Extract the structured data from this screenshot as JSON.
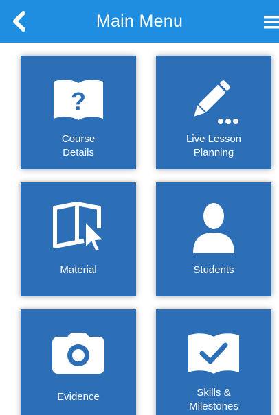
{
  "header": {
    "title": "Main Menu",
    "back_icon": "chevron-left-icon",
    "menu_icon": "hamburger-menu-icon",
    "color": "#1f8ee0"
  },
  "tiles": [
    {
      "label": "Course\nDetails",
      "icon": "book-question-icon"
    },
    {
      "label": "Live Lesson\nPlanning",
      "icon": "pencil-dots-icon"
    },
    {
      "label": "Material",
      "icon": "open-book-cursor-icon"
    },
    {
      "label": "Students",
      "icon": "person-silhouette-icon"
    },
    {
      "label": "Evidence",
      "icon": "camera-icon"
    },
    {
      "label": "Skills &\nMilestones",
      "icon": "book-checkmark-icon"
    }
  ],
  "tile_color": "#2d6fb6"
}
